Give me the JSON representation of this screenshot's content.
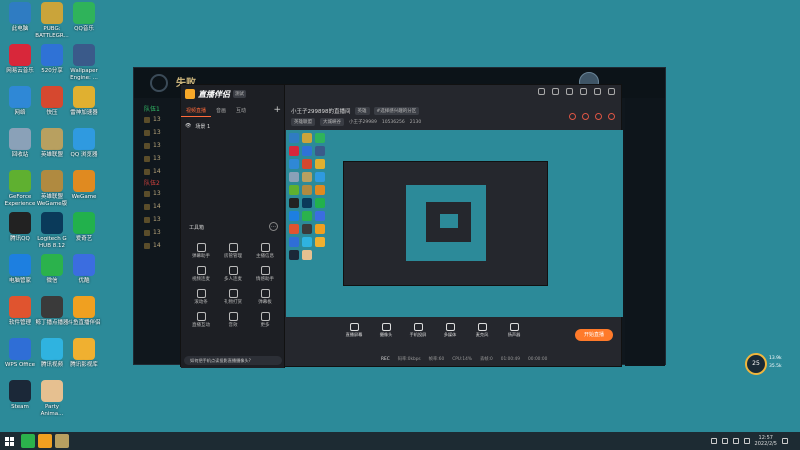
{
  "desktop": {
    "icons": [
      {
        "label": "此电脑",
        "color": "#2f7cc2"
      },
      {
        "label": "PUBG:\nBATTLEGR...",
        "color": "#caa43a"
      },
      {
        "label": "QQ音乐",
        "color": "#2fb35a"
      },
      {
        "label": "网易云音乐",
        "color": "#d8273a"
      },
      {
        "label": "520分享",
        "color": "#2f72d6"
      },
      {
        "label": "Wallpaper\nEngine: ...",
        "color": "#3a5a8a"
      },
      {
        "label": "网络",
        "color": "#2f88d6"
      },
      {
        "label": "快压",
        "color": "#d6482f"
      },
      {
        "label": "雷神加速器",
        "color": "#e0b030"
      },
      {
        "label": "回收站",
        "color": "#8aa1b8"
      },
      {
        "label": "英雄联盟",
        "color": "#b8a060"
      },
      {
        "label": "QQ 浏览器",
        "color": "#2f9ae0"
      },
      {
        "label": "GeForce\nExperience",
        "color": "#5fb030"
      },
      {
        "label": "英雄联盟\nWeGame版",
        "color": "#b08a40"
      },
      {
        "label": "WeGame",
        "color": "#e08a20"
      },
      {
        "label": "腾讯QQ",
        "color": "#222"
      },
      {
        "label": "Logitech G\nHUB 8.12",
        "color": "#0a3a5a"
      },
      {
        "label": "爱奇艺",
        "color": "#22b14c"
      },
      {
        "label": "电脑管家",
        "color": "#1d7fe0"
      },
      {
        "label": "微信",
        "color": "#2bb24c"
      },
      {
        "label": "优酷",
        "color": "#3b6de0"
      },
      {
        "label": "软件管理",
        "color": "#e0542f"
      },
      {
        "label": "鲸丁播点播器",
        "color": "#3a3a3a"
      },
      {
        "label": "斗鱼直播伴侣",
        "color": "#f0a020"
      },
      {
        "label": "WPS Office",
        "color": "#2f6ed6"
      },
      {
        "label": "腾讯视频",
        "color": "#2fb3e0"
      },
      {
        "label": "腾讯影视库",
        "color": "#f0b030"
      },
      {
        "label": "Steam",
        "color": "#1b2838"
      },
      {
        "label": "Party\nAnima...",
        "color": "#e6c090"
      }
    ]
  },
  "game": {
    "title": "失败",
    "team_blue": "队伍1",
    "team_red": "队伍2",
    "right_lines": [
      "你了",
      "了",
      "我的",
      "了"
    ]
  },
  "stream_app": {
    "logo_text": "直播伴侣",
    "version": "测试",
    "tabs": [
      "视频直播",
      "音画",
      "互动"
    ],
    "scene_label": "场景 1",
    "tools_title": "工具箱",
    "tools": [
      {
        "label": "弹幕助手"
      },
      {
        "label": "房管管理"
      },
      {
        "label": "主播信息"
      },
      {
        "label": "视频连麦"
      },
      {
        "label": "多人连麦"
      },
      {
        "label": "情感助手"
      },
      {
        "label": "滚动条"
      },
      {
        "label": "礼物打赏"
      },
      {
        "label": "弹幕板"
      },
      {
        "label": "直播互动"
      },
      {
        "label": "音效"
      },
      {
        "label": "更多"
      }
    ],
    "notice": "如何把手机点读投影直播摄像头?",
    "room_title": "小王子299898的直播间",
    "room_tag": "英雄",
    "room_tag2": "#选择感兴趣的分区",
    "room_category": "英雄联盟",
    "room_sub": "大城峡谷",
    "room_user": "小王子29989",
    "room_id": "10536256",
    "room_count": "2130",
    "toolbar": [
      {
        "label": "直播屏幕"
      },
      {
        "label": "摄像头"
      },
      {
        "label": "手机投屏"
      },
      {
        "label": "多媒体"
      },
      {
        "label": "麦克风"
      },
      {
        "label": "扬声器"
      }
    ],
    "start_label": "开始直播",
    "status": {
      "rec": "REC",
      "duration": "01:00:49",
      "bitrate": "码率:0kbps",
      "fps": "帧率:60",
      "cpu": "CPU:14%",
      "drop": "丢帧:0",
      "time2": "00:00:00"
    }
  },
  "taskbar": {
    "time": "12:57",
    "date": "2022/2/5"
  },
  "net_monitor": {
    "percent": "25",
    "up": "13.9k",
    "down": "35.5k"
  }
}
